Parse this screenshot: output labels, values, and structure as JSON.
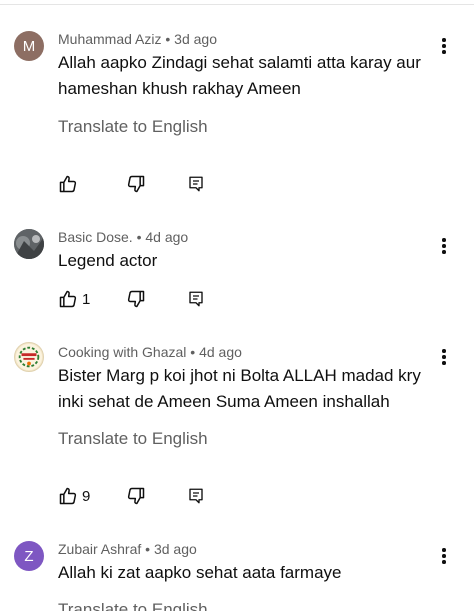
{
  "comments": [
    {
      "author": "Muhammad Aziz",
      "age": "3d ago",
      "avatar_letter": "M",
      "avatar_color": "#8d6e63",
      "text_lines": [
        "Allah aapko Zindagi sehat salamti atta karay aur",
        "hameshan khush rakhay Ameen"
      ],
      "translate_label": "Translate to English",
      "likes": ""
    },
    {
      "author": "Basic Dose.",
      "age": "4d ago",
      "avatar_letter": "",
      "avatar_color": "#6d7275",
      "text_lines": [
        "Legend actor"
      ],
      "translate_label": "",
      "likes": "1"
    },
    {
      "author": "Cooking with Ghazal",
      "age": "4d ago",
      "avatar_letter": "",
      "avatar_color": "#f3e6c8",
      "text_lines": [
        "Bister Marg p koi jhot ni Bolta ALLAH madad kry",
        "inki sehat de Ameen Suma Ameen inshallah"
      ],
      "translate_label": "Translate to English",
      "likes": "9"
    },
    {
      "author": "Zubair Ashraf",
      "age": "3d ago",
      "avatar_letter": "Z",
      "avatar_color": "#7e57c2",
      "text_lines": [
        "Allah ki zat aapko sehat aata farmaye"
      ],
      "translate_label": "Translate to English",
      "likes": ""
    }
  ],
  "meta_separator": " • "
}
